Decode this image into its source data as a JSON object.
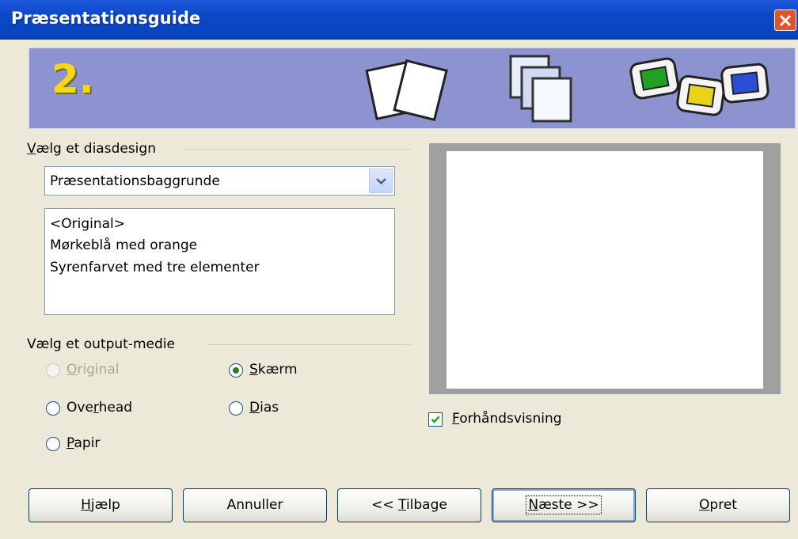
{
  "window": {
    "title": "Præsentationsguide"
  },
  "banner": {
    "step": "2."
  },
  "design_group": {
    "label_prefix": "",
    "label_u": "V",
    "label_rest": "ælg et diasdesign",
    "combo_value": "Præsentationsbaggrunde",
    "items": [
      "<Original>",
      "Mørkeblå med orange",
      "Syrenfarvet med tre elementer"
    ]
  },
  "output_group": {
    "label": "Vælg et output-medie",
    "options": [
      {
        "u": "O",
        "rest": "riginal",
        "pre": "",
        "disabled": true,
        "checked": false
      },
      {
        "pre": "",
        "u": "S",
        "rest": "kærm",
        "disabled": false,
        "checked": true
      },
      {
        "pre": "Ove",
        "u": "r",
        "rest": "head",
        "disabled": false,
        "checked": false
      },
      {
        "pre": "",
        "u": "D",
        "rest": "ias",
        "disabled": false,
        "checked": false
      },
      {
        "pre": "",
        "u": "P",
        "rest": "apir",
        "disabled": false,
        "checked": false
      }
    ]
  },
  "preview_checkbox": {
    "pre": "",
    "u": "F",
    "rest": "orhåndsvisning",
    "checked": true
  },
  "buttons": {
    "help": {
      "u": "H",
      "rest": "jælp"
    },
    "cancel": {
      "label": "Annuller"
    },
    "back": {
      "pre": "<< ",
      "u": "T",
      "rest": "ilbage"
    },
    "next": {
      "u": "N",
      "rest": "æste >>"
    },
    "create": {
      "u": "O",
      "rest": "pret"
    }
  },
  "colors": {
    "titlebar": "#0a48c8",
    "banner": "#8c93ce",
    "step_number": "#f7d617",
    "dialog_bg": "#ece9d8"
  }
}
